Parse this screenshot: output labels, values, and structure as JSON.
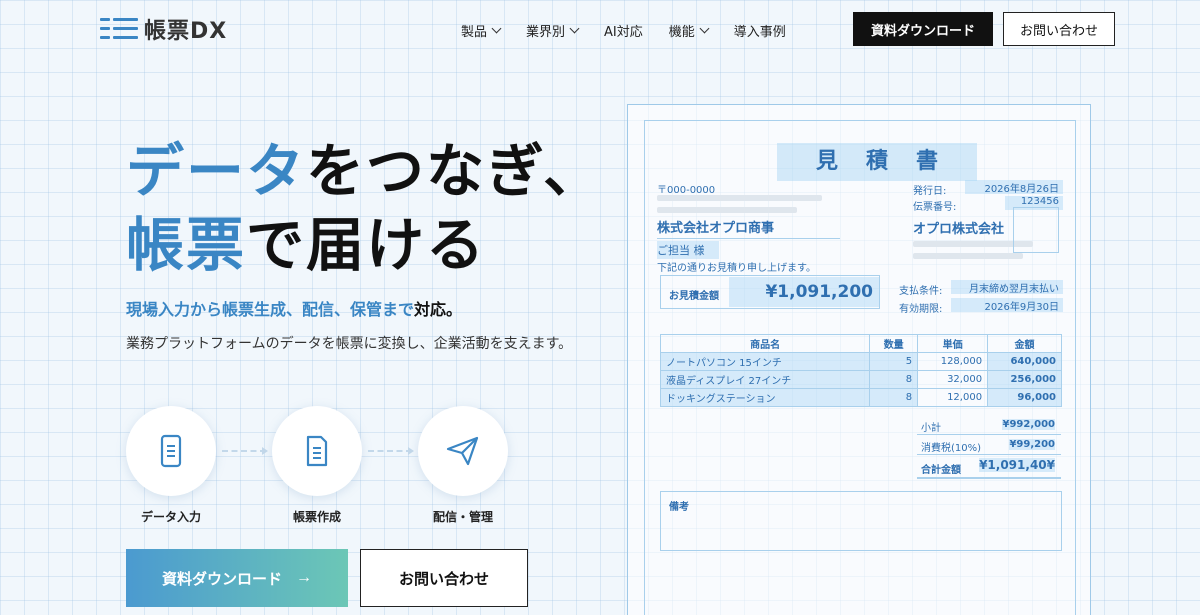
{
  "header": {
    "logo": "帳票DX",
    "nav": [
      {
        "label": "製品",
        "dropdown": true
      },
      {
        "label": "業界別",
        "dropdown": true
      },
      {
        "label": "AI対応",
        "dropdown": false
      },
      {
        "label": "機能",
        "dropdown": true
      },
      {
        "label": "導入事例",
        "dropdown": false
      }
    ],
    "download_label": "資料ダウンロード",
    "contact_label": "お問い合わせ"
  },
  "hero": {
    "line1_blue": "データ",
    "line1_dark": "をつなぎ、",
    "line2_blue": "帳票",
    "line2_dark": "で届ける",
    "subhead_blue": "現場入力から帳票生成、配信、保管まで",
    "subhead_dark": "対応。",
    "description": "業務プラットフォームのデータを帳票に変換し、企業活動を支えます。",
    "flow": [
      {
        "label": "データ入力",
        "icon": "phone-icon"
      },
      {
        "label": "帳票作成",
        "icon": "document-icon"
      },
      {
        "label": "配信・管理",
        "icon": "send-icon"
      }
    ],
    "cta_download": "資料ダウンロード",
    "cta_arrow": "→",
    "cta_contact": "お問い合わせ"
  },
  "doc": {
    "title": "見積書",
    "postal": "〒000-0000",
    "issue_label": "発行日:",
    "issue_date": "2026年8月26日",
    "slip_label": "伝票番号:",
    "slip_no": "123456",
    "customer": "株式会社オプロ商事",
    "contact": "ご担当 様",
    "intro": "下記の通りお見積り申し上げます。",
    "issuer": "オプロ株式会社",
    "total_label": "お見積金額",
    "total_value": "¥1,091,200",
    "payment_label": "支払条件:",
    "payment_value": "月末締め翌月末払い",
    "expiry_label": "有効期限:",
    "expiry_value": "2026年9月30日",
    "headers": [
      "商品名",
      "数量",
      "単価",
      "金額"
    ],
    "rows": [
      [
        "ノートパソコン 15インチ",
        "5",
        "128,000",
        "640,000"
      ],
      [
        "液晶ディスプレイ 27インチ",
        "8",
        "32,000",
        "256,000"
      ],
      [
        "ドッキングステーション",
        "8",
        "12,000",
        "96,000"
      ]
    ],
    "subtotal_label": "小計",
    "subtotal_value": "¥992,000",
    "tax_label": "消費税(10%)",
    "tax_value": "¥99,200",
    "grand_label": "合計金額",
    "grand_value": "¥1,091,40¥",
    "remarks_label": "備考"
  }
}
